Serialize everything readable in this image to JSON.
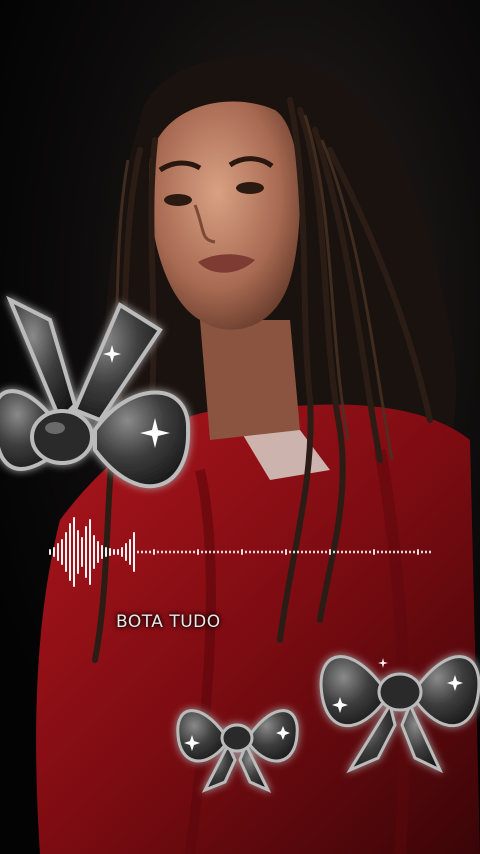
{
  "audio_visualizer": {
    "caption": "BOTA TUDO",
    "playback_progress": 0.22
  },
  "decorations": {
    "icon": "bow-icon",
    "count": 3
  },
  "colors": {
    "background": "#050505",
    "jersey_red": "#8a0f14",
    "waveform": "#ffffff",
    "bow_gray": "#3b3b3b"
  }
}
